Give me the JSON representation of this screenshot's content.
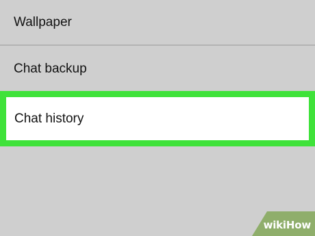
{
  "settings_list": {
    "items": [
      {
        "label": "Wallpaper"
      },
      {
        "label": "Chat backup"
      },
      {
        "label": "Chat history"
      }
    ]
  },
  "highlight": {
    "color": "#3fe23a",
    "target": "Chat history"
  },
  "watermark": {
    "text": "wikiHow",
    "color": "#8fae6b"
  }
}
